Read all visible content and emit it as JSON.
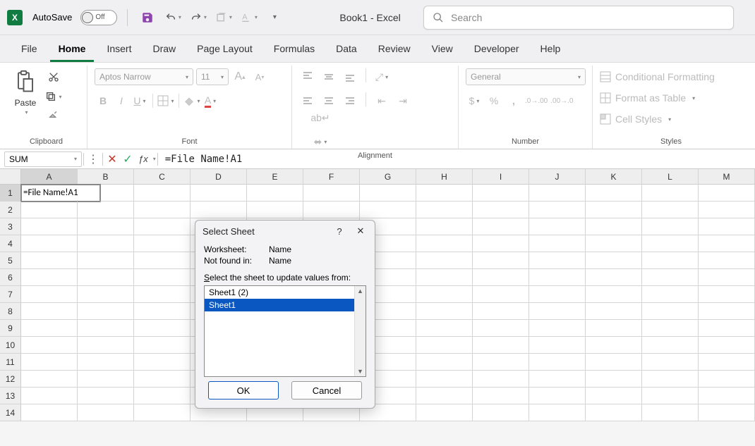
{
  "titlebar": {
    "autosave_label": "AutoSave",
    "autosave_state": "Off",
    "doc_title": "Book1  -  Excel",
    "search_placeholder": "Search"
  },
  "tabs": [
    "File",
    "Home",
    "Insert",
    "Draw",
    "Page Layout",
    "Formulas",
    "Data",
    "Review",
    "View",
    "Developer",
    "Help"
  ],
  "active_tab": "Home",
  "ribbon": {
    "clipboard": {
      "paste": "Paste",
      "label": "Clipboard"
    },
    "font": {
      "name": "Aptos Narrow",
      "size": "11",
      "label": "Font"
    },
    "alignment": {
      "label": "Alignment"
    },
    "number": {
      "format": "General",
      "label": "Number"
    },
    "styles": {
      "cond": "Conditional Formatting",
      "table": "Format as Table",
      "cell": "Cell Styles",
      "label": "Styles"
    }
  },
  "formula_bar": {
    "namebox": "SUM",
    "formula": "=File Name!A1"
  },
  "grid": {
    "columns": [
      "A",
      "B",
      "C",
      "D",
      "E",
      "F",
      "G",
      "H",
      "I",
      "J",
      "K",
      "L",
      "M"
    ],
    "rows": [
      "1",
      "2",
      "3",
      "4",
      "5",
      "6",
      "7",
      "8",
      "9",
      "10",
      "11",
      "12",
      "13",
      "14"
    ],
    "active_cell_value": "=File Name!A1"
  },
  "dialog": {
    "title": "Select Sheet",
    "worksheet_lbl": "Worksheet:",
    "worksheet_val": "Name",
    "notfound_lbl": "Not found in:",
    "notfound_val": "Name",
    "instruction_pre": "S",
    "instruction": "elect the sheet to update values from:",
    "items": [
      "Sheet1 (2)",
      "Sheet1"
    ],
    "selected": "Sheet1",
    "ok": "OK",
    "cancel": "Cancel"
  }
}
